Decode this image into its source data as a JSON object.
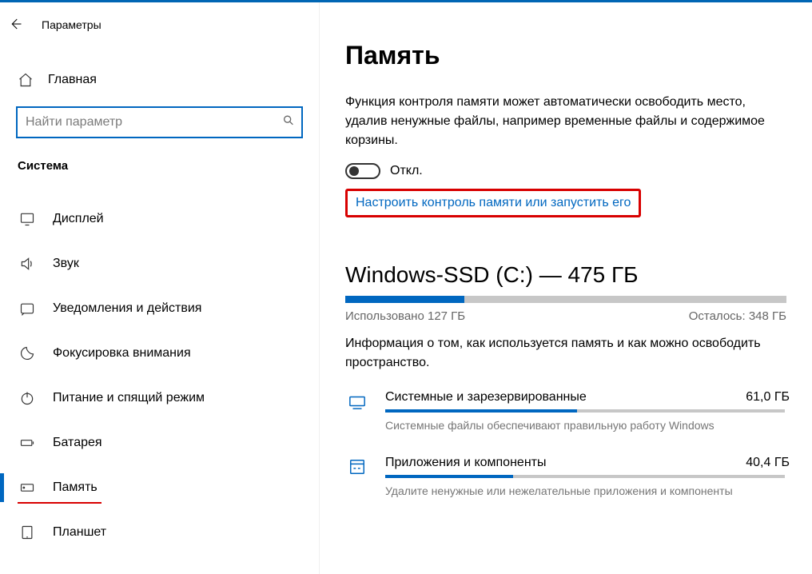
{
  "window": {
    "title": "Параметры"
  },
  "sidebar": {
    "home": "Главная",
    "search_placeholder": "Найти параметр",
    "section": "Система",
    "items": [
      {
        "key": "display",
        "label": "Дисплей"
      },
      {
        "key": "sound",
        "label": "Звук"
      },
      {
        "key": "notify",
        "label": "Уведомления и действия"
      },
      {
        "key": "focus",
        "label": "Фокусировка внимания"
      },
      {
        "key": "power",
        "label": "Питание и спящий режим"
      },
      {
        "key": "battery",
        "label": "Батарея"
      },
      {
        "key": "storage",
        "label": "Память"
      },
      {
        "key": "tablet",
        "label": "Планшет"
      }
    ]
  },
  "main": {
    "heading": "Память",
    "description": "Функция контроля памяти может автоматически освободить место, удалив ненужные файлы, например временные файлы и содержимое корзины.",
    "toggle_state": "Откл.",
    "config_link": "Настроить контроль памяти или запустить его",
    "drive": {
      "title": "Windows-SSD (C:) — 475 ГБ",
      "used_label": "Использовано 127 ГБ",
      "free_label": "Осталось: 348 ГБ",
      "fill_pct": 27
    },
    "info": "Информация о том, как используется память и как можно освободить пространство.",
    "categories": [
      {
        "name": "Системные и зарезервированные",
        "size": "61,0 ГБ",
        "desc": "Системные файлы обеспечивают правильную работу Windows",
        "fill_pct": 48
      },
      {
        "name": "Приложения и компоненты",
        "size": "40,4 ГБ",
        "desc": "Удалите ненужные или нежелательные приложения и компоненты",
        "fill_pct": 32
      }
    ]
  }
}
